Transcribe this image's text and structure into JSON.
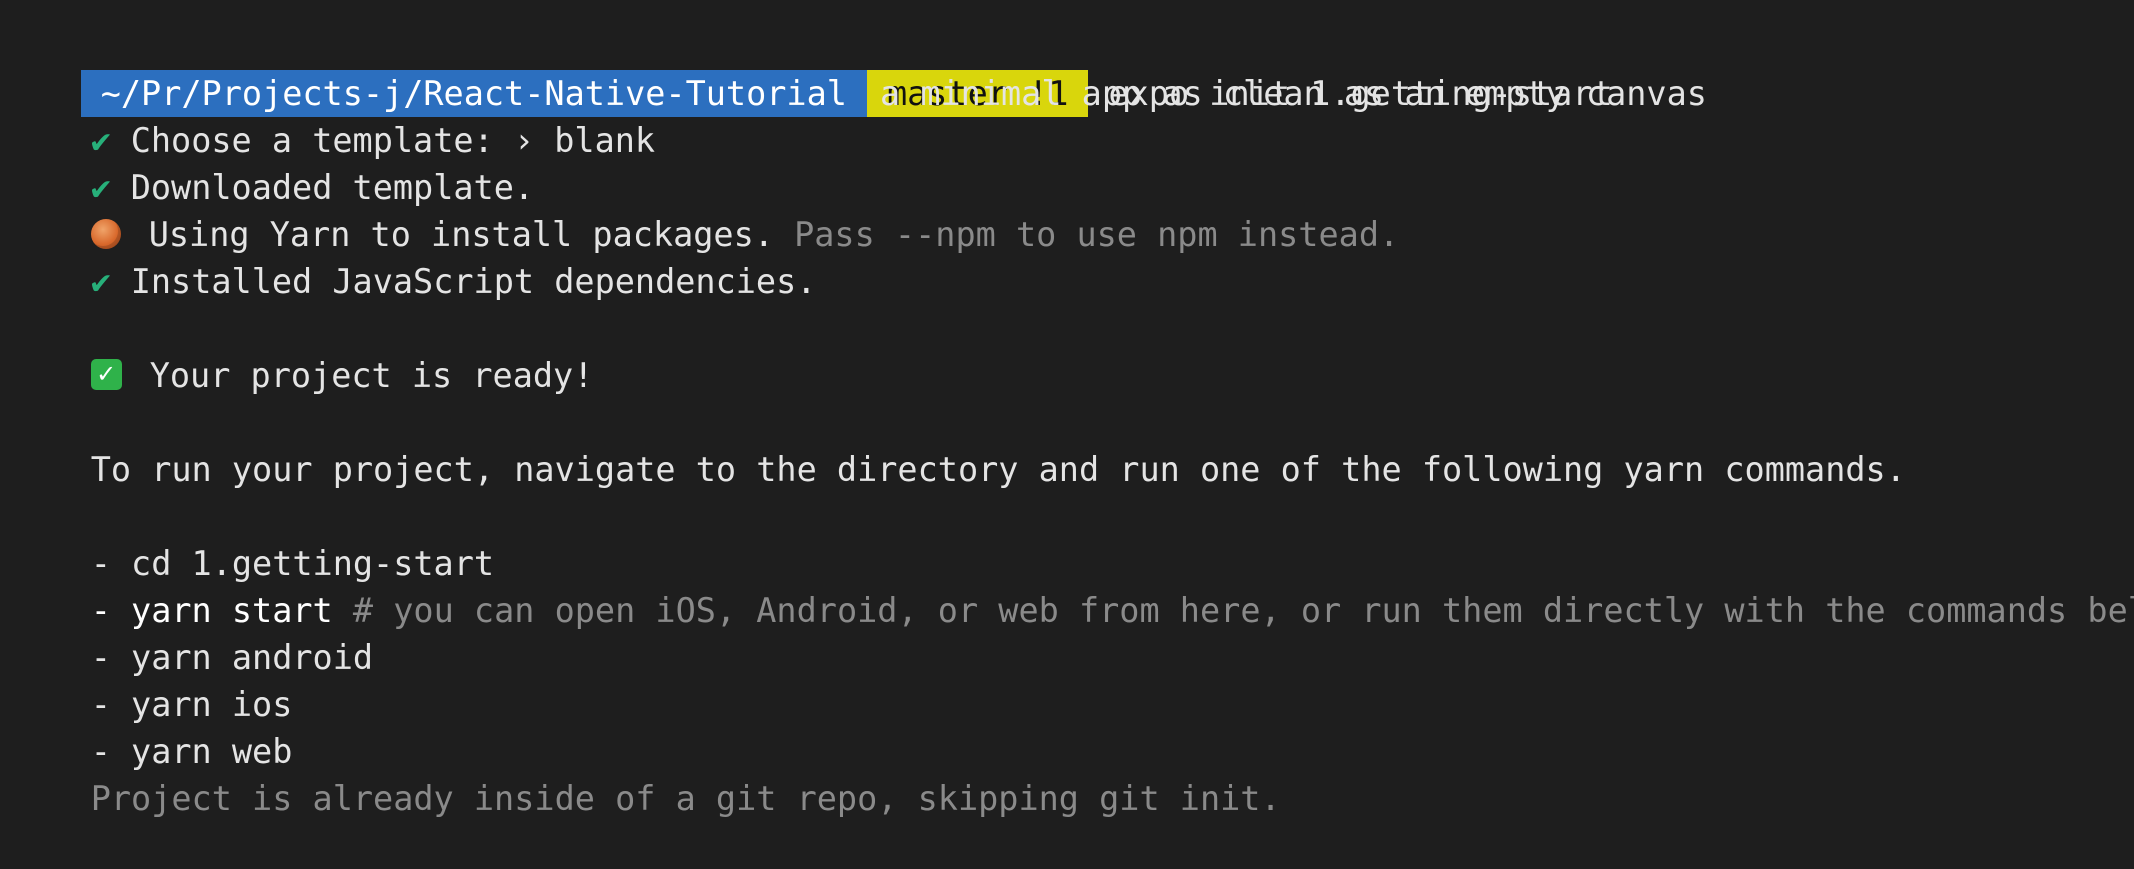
{
  "prompt": {
    "path": "~/Pr/Projects-j/React-Native-Tutorial",
    "branch": "master !1",
    "command": "expo init 1.getting-start"
  },
  "output": {
    "template_label": "Choose a template: › blank",
    "template_desc": "a minimal app as clean as an empty canvas",
    "downloaded": "Downloaded template.",
    "yarn_main": "Using Yarn to install packages.",
    "yarn_hint": "Pass --npm to use npm instead.",
    "installed": "Installed JavaScript dependencies.",
    "ready": "Your project is ready!",
    "instructions": "To run your project, navigate to the directory and run one of the following yarn commands.",
    "cmd_cd": "- cd 1.getting-start",
    "cmd_start": "- yarn start",
    "cmd_start_comment": "# you can open iOS, Android, or web from here, or run them directly with the commands below.",
    "cmd_android": "- yarn android",
    "cmd_ios": "- yarn ios",
    "cmd_web": "- yarn web",
    "git_notice": "Project is already inside of a git repo, skipping git init."
  },
  "icons": {
    "check": "✔",
    "done": "✓",
    "yarn": "yarn-ball-icon"
  },
  "colors": {
    "background": "#1e1e1e",
    "path_segment": "#2c6fbf",
    "branch_segment": "#d9d60c",
    "check_green": "#27b07a",
    "dim_text": "#8a8a8a"
  }
}
